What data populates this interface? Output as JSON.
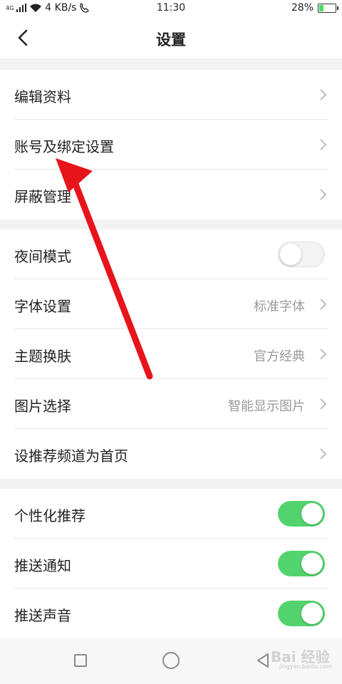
{
  "status_bar": {
    "network": "4G",
    "speed": "4 KB/s",
    "time": "11:30",
    "battery_percent": "28%",
    "battery_level": 0.28,
    "battery_color": "#4cd964"
  },
  "header": {
    "title": "设置",
    "back_icon": "chevron-left-icon"
  },
  "groups": [
    {
      "items": [
        {
          "label": "编辑资料",
          "type": "chevron"
        },
        {
          "label": "账号及绑定设置",
          "type": "chevron"
        },
        {
          "label": "屏蔽管理",
          "type": "chevron"
        }
      ]
    },
    {
      "items": [
        {
          "label": "夜间模式",
          "type": "toggle",
          "on": false
        },
        {
          "label": "字体设置",
          "value": "标准字体",
          "type": "chevron"
        },
        {
          "label": "主题换肤",
          "value": "官方经典",
          "type": "chevron"
        },
        {
          "label": "图片选择",
          "value": "智能显示图片",
          "type": "chevron"
        },
        {
          "label": "设推荐频道为首页",
          "type": "chevron"
        }
      ]
    },
    {
      "items": [
        {
          "label": "个性化推荐",
          "type": "toggle",
          "on": true
        },
        {
          "label": "推送通知",
          "type": "toggle",
          "on": true
        },
        {
          "label": "推送声音",
          "type": "toggle",
          "on": true
        }
      ]
    }
  ],
  "colors": {
    "toggle_on": "#53d36d",
    "annotation_arrow": "#e8141b"
  },
  "watermark": {
    "text": "Bai 经验",
    "sub": "jingyan.baidu.com"
  },
  "bottom_nav": {
    "icons": [
      "recent-apps-icon",
      "home-icon",
      "back-triangle-icon"
    ]
  }
}
